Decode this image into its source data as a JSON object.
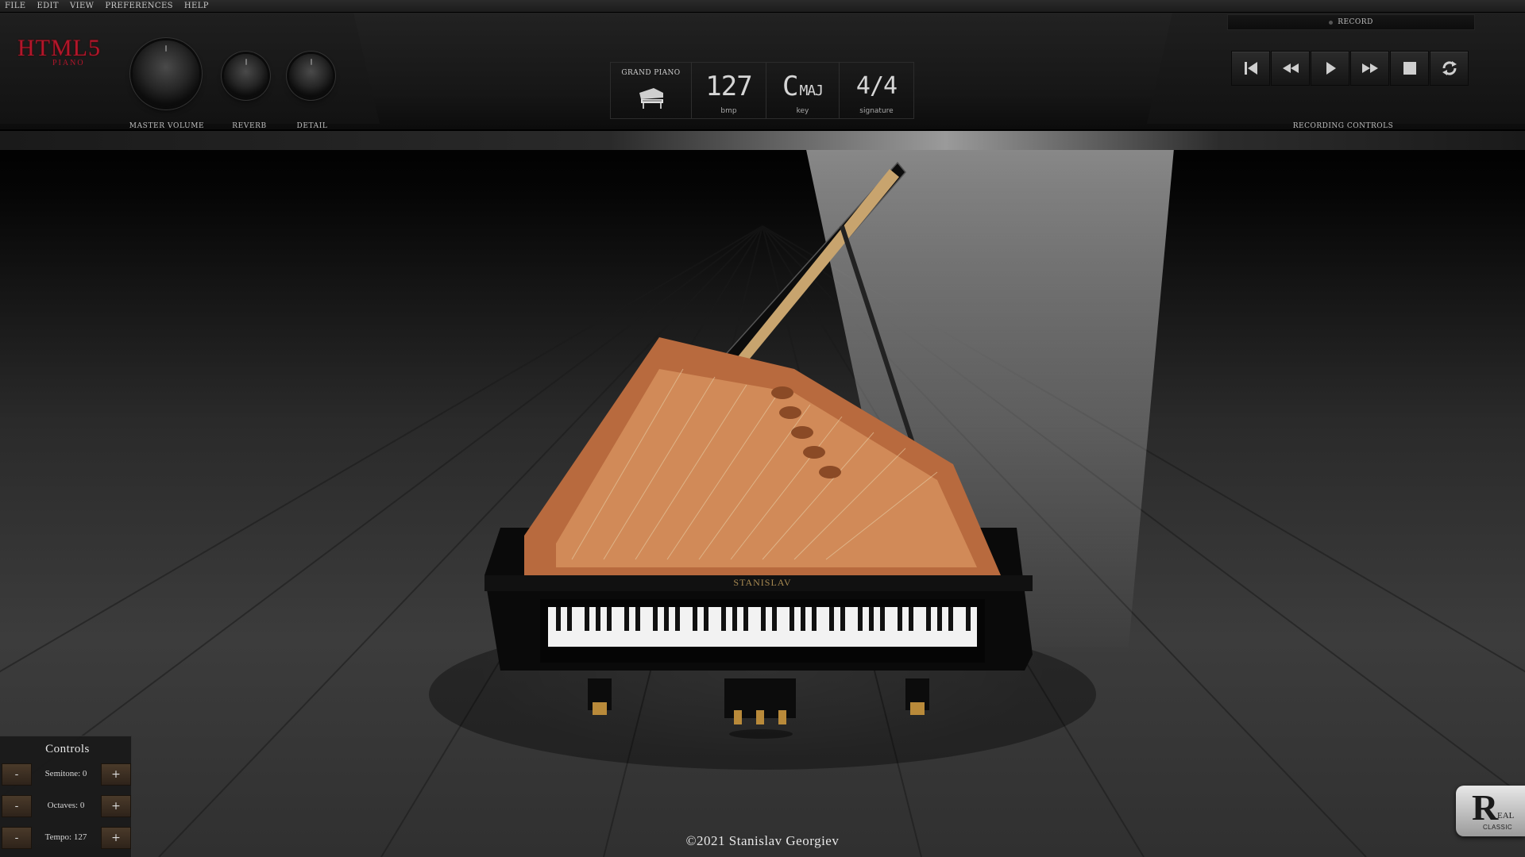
{
  "menu": [
    "FILE",
    "EDIT",
    "VIEW",
    "PREFERENCES",
    "HELP"
  ],
  "logo": {
    "main": "HTML5",
    "sub": "PIANO"
  },
  "knobs": {
    "master_volume": "MASTER VOLUME",
    "reverb": "REVERB",
    "detail": "DETAIL"
  },
  "display": {
    "instrument": "GRAND PIANO",
    "bpm_value": "127",
    "bpm_label": "bmp",
    "key_note": "C",
    "key_mode": "MAJ",
    "key_label": "key",
    "signature_value": "4/4",
    "signature_label": "signature"
  },
  "recording": {
    "record_label": "RECORD",
    "controls_label": "RECORDING CONTROLS",
    "buttons": [
      "skip-to-start",
      "rewind",
      "play",
      "fast-forward",
      "stop",
      "loop"
    ]
  },
  "piano": {
    "brand": "STANISLAV"
  },
  "controls": {
    "title": "Controls",
    "minus": "-",
    "plus": "+",
    "semitone": "Semitone: 0",
    "octaves": "Octaves: 0",
    "tempo": "Tempo: 127"
  },
  "copyright": "©2021 Stanislav Georgiev",
  "badge": {
    "letter": "R",
    "rest": "EAL",
    "sub": "CLASSIC"
  },
  "colors": {
    "logo_red": "#b3162b",
    "panel_dark": "#161616",
    "lid_wood": "#c8774a"
  }
}
